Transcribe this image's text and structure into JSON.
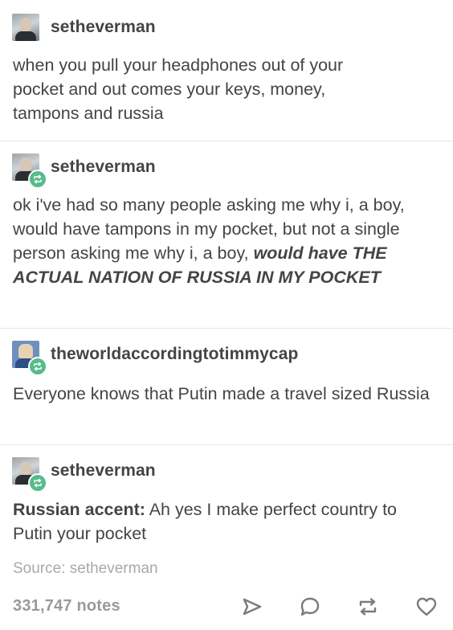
{
  "posts": [
    {
      "username": "setheverman",
      "reblog": false,
      "avatar": "person-avatar",
      "text_lines": [
        "when you pull your headphones out of your",
        "pocket and out comes your keys, money,",
        "tampons and russia"
      ]
    },
    {
      "username": "setheverman",
      "reblog": true,
      "avatar": "person-avatar",
      "text_plain": "ok i've had so many people asking me why i, a boy, would have tampons in my pocket, but not a single person asking me why i, a boy,",
      "text_shout": "would have THE ACTUAL NATION OF RUSSIA IN MY POCKET"
    },
    {
      "username": "theworldaccordingtotimmycap",
      "reblog": true,
      "avatar": "cartoon-avatar",
      "text": "Everyone knows that Putin made a travel sized Russia"
    },
    {
      "username": "setheverman",
      "reblog": true,
      "avatar": "person-avatar",
      "text_bold": "Russian accent:",
      "text_rest": " Ah yes I make perfect country to Putin your pocket"
    }
  ],
  "source": {
    "label": "Source:",
    "name": "setheverman"
  },
  "footer": {
    "notes": "331,747 notes",
    "icons": [
      "share-icon",
      "reply-icon",
      "reblog-icon",
      "like-icon"
    ]
  },
  "colors": {
    "text": "#444444",
    "muted": "#a9a9a9",
    "reblog_green": "#56bc8a",
    "icon_gray": "#7b7b7b"
  }
}
